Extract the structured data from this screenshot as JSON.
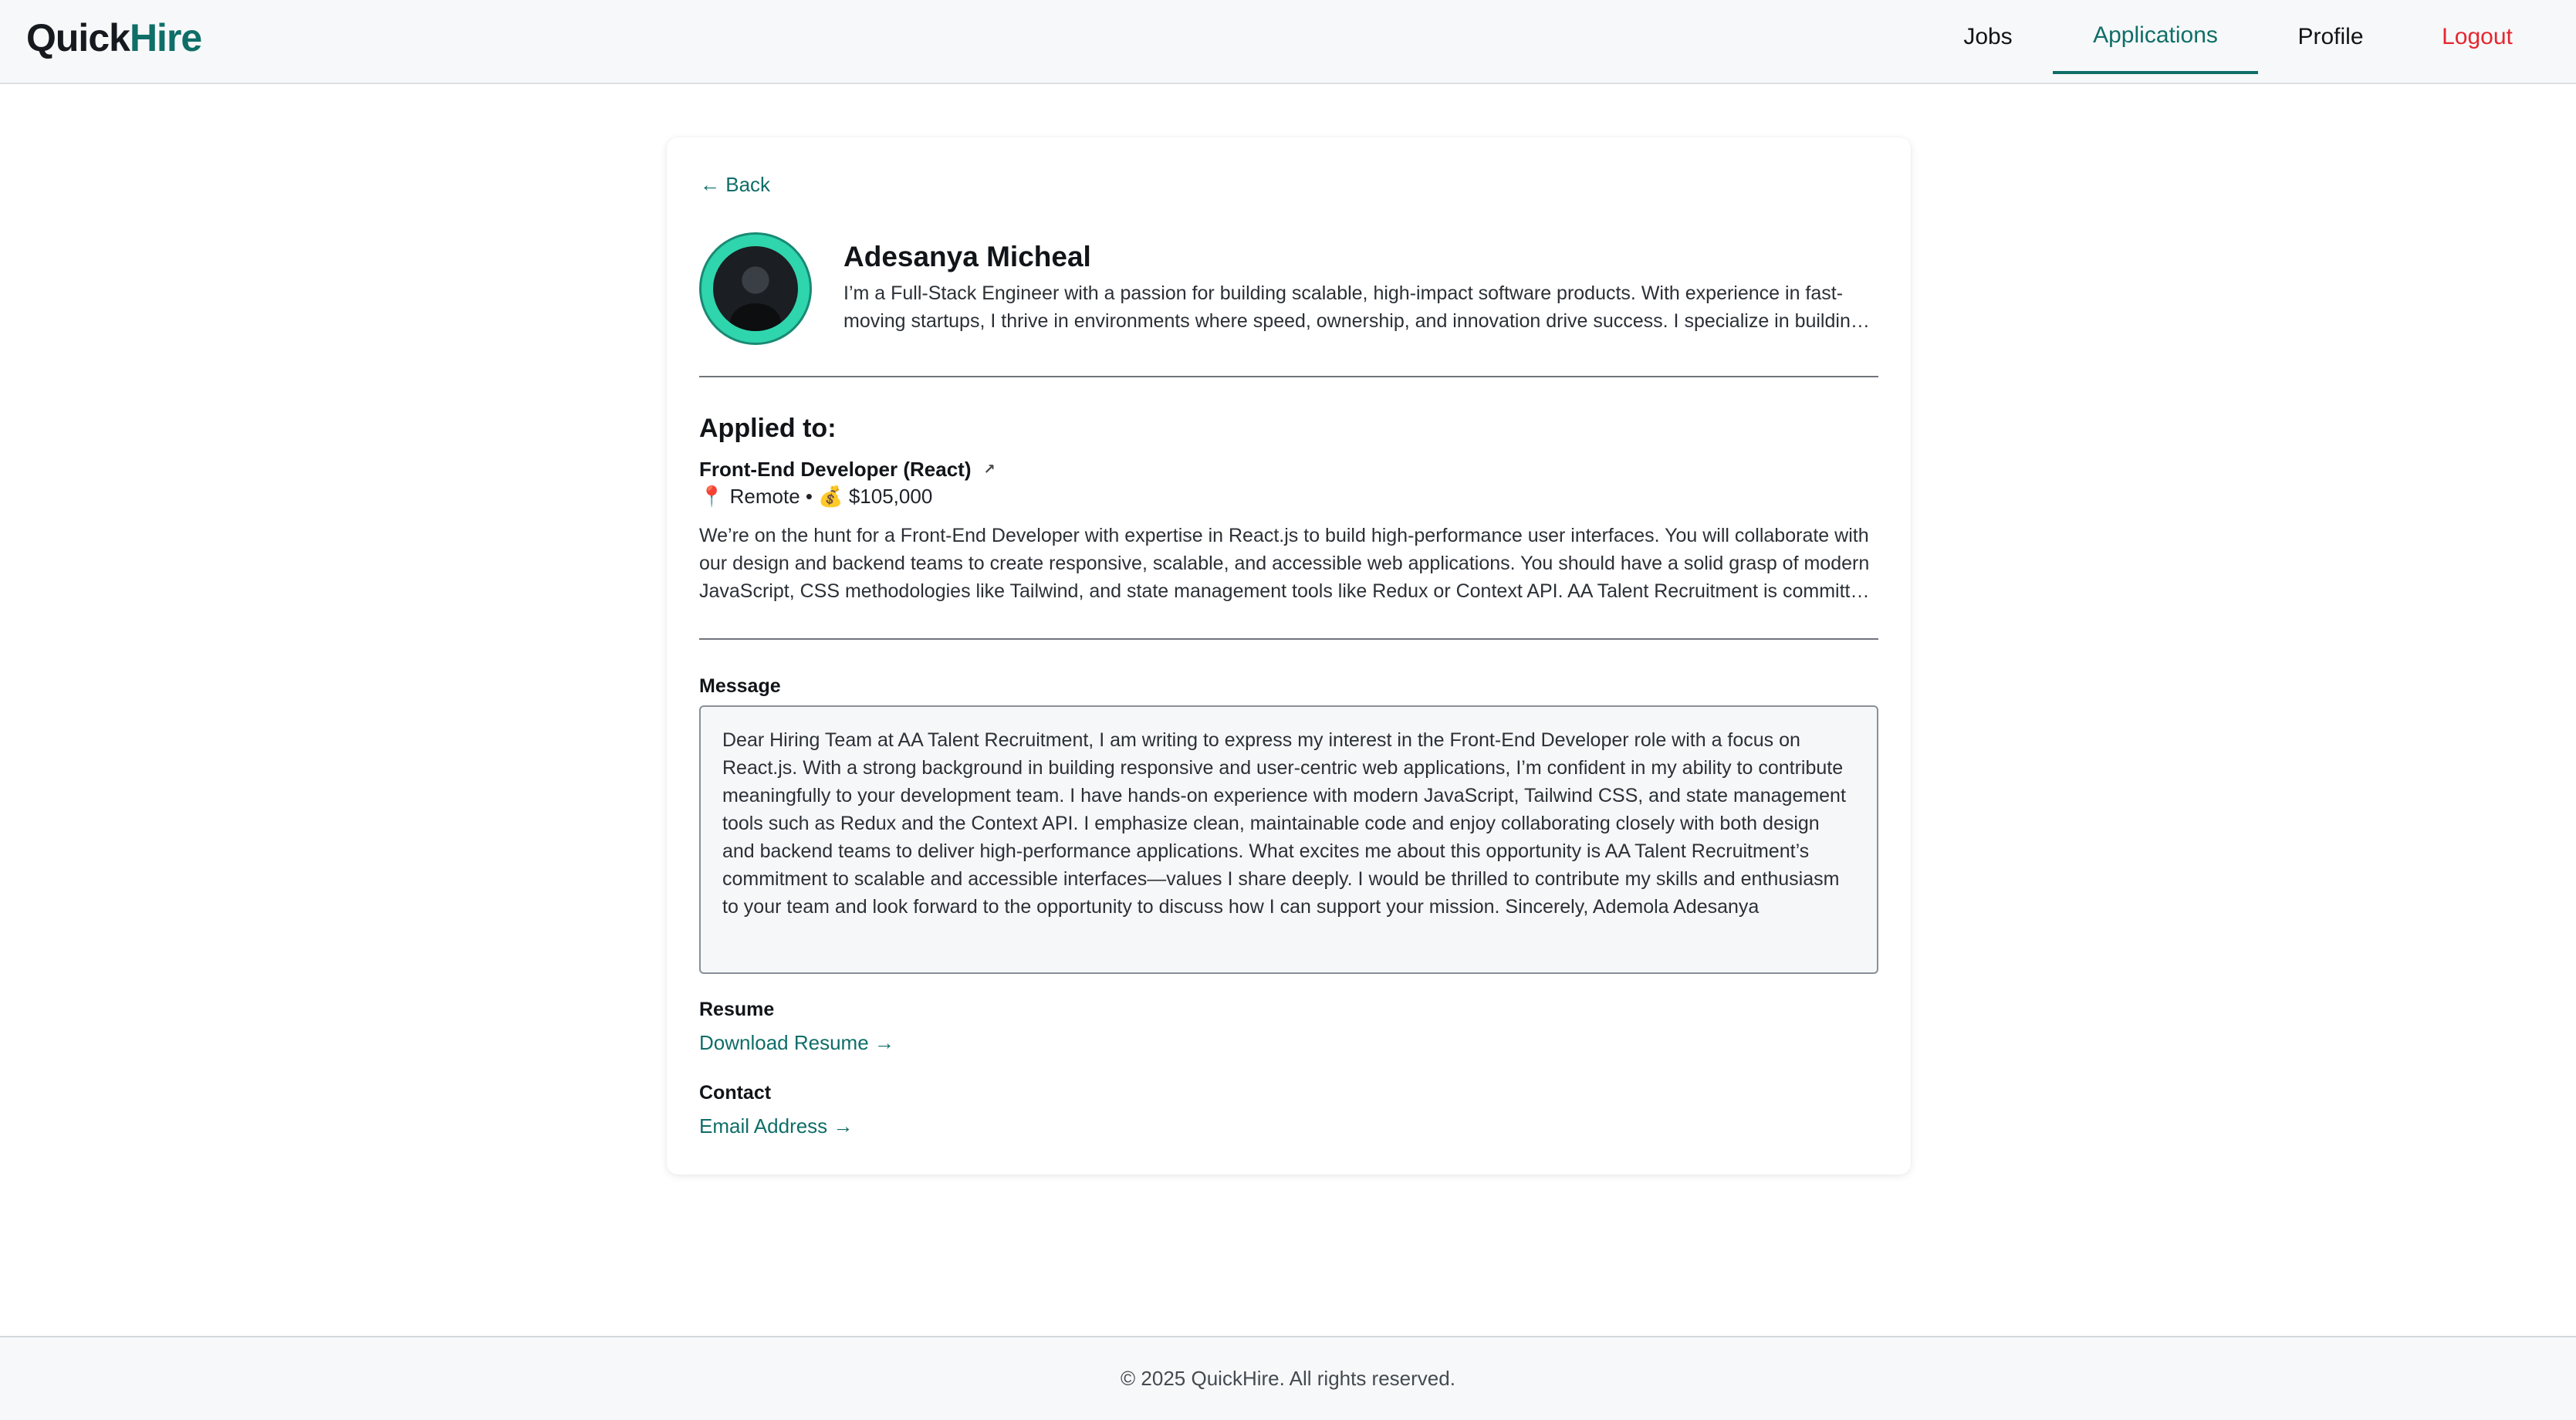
{
  "brand": {
    "part1": "Quick",
    "part2": "Hire",
    "accent_color": "#0f6e68"
  },
  "nav": {
    "jobs": "Jobs",
    "applications": "Applications",
    "profile": "Profile",
    "logout": "Logout",
    "active": "applications",
    "logout_color": "#e5262f"
  },
  "applicant": {
    "back_label": "← Back",
    "name": "Adesanya Micheal",
    "bio": "I’m a Full-Stack Engineer with a passion for building scalable, high-impact software products. With experience in fast-moving startups, I thrive in environments where speed, ownership, and innovation drive success. I specialize in building end-to-end solutions across the stack."
  },
  "job": {
    "section_title": "Applied to:",
    "title": "Front-End Developer (React)",
    "external_icon": "external-link-icon",
    "location_icon": "📍",
    "location": "Remote",
    "separator": "•",
    "salary_icon": "💰",
    "salary": "$105,000",
    "description": "We’re on the hunt for a Front-End Developer with expertise in React.js to build high-performance user interfaces. You will collaborate with our design and backend teams to create responsive, scalable, and accessible web applications. You should have a solid grasp of modern JavaScript, CSS methodologies like Tailwind, and state management tools like Redux or Context API. AA Talent Recruitment is committed to building great products."
  },
  "message": {
    "label": "Message",
    "body": "Dear Hiring Team at AA Talent Recruitment, I am writing to express my interest in the Front-End Developer role with a focus on React.js. With a strong background in building responsive and user-centric web applications, I’m confident in my ability to contribute meaningfully to your development team. I have hands-on experience with modern JavaScript, Tailwind CSS, and state management tools such as Redux and the Context API. I emphasize clean, maintainable code and enjoy collaborating closely with both design and backend teams to deliver high-performance applications. What excites me about this opportunity is AA Talent Recruitment’s commitment to scalable and accessible interfaces—values I share deeply. I would be thrilled to contribute my skills and enthusiasm to your team and look forward to the opportunity to discuss how I can support your mission. Sincerely, Ademola Adesanya"
  },
  "resume": {
    "label": "Resume",
    "link": "Download Resume →"
  },
  "contact": {
    "label": "Contact",
    "link": "Email Address →"
  },
  "footer": {
    "text": "© 2025 QuickHire. All rights reserved."
  }
}
